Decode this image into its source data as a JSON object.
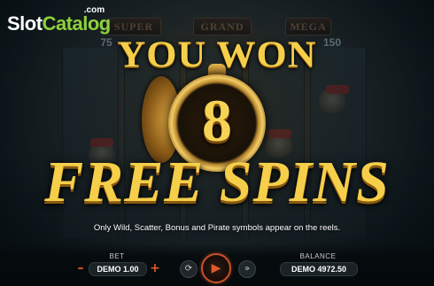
{
  "logo": {
    "slot": "Slot",
    "catalog": "Catalog",
    "com": ".com"
  },
  "background": {
    "signs": [
      "SUPER",
      "GRAND",
      "MEGA"
    ],
    "jackpots": [
      "75",
      "150"
    ]
  },
  "win_popup": {
    "heading": "YOU WON",
    "count": "8",
    "subheading": "FREE SPINS",
    "info": "Only Wild, Scatter, Bonus and Pirate symbols appear on the reels."
  },
  "bottom_bar": {
    "bet_label": "BET",
    "bet_value": "DEMO 1.00",
    "balance_label": "BALANCE",
    "balance_value": "DEMO 4972.50"
  },
  "colors": {
    "gold_text": "#f6cf4a",
    "accent_orange": "#e0592a",
    "logo_green": "#8dd13a"
  },
  "icons": {
    "bet_decrease": "minus-icon",
    "bet_increase": "plus-icon",
    "auto_spin": "autoplay-icon",
    "spin": "play-icon",
    "turbo": "turbo-icon",
    "watch": "pocket-watch-icon"
  }
}
